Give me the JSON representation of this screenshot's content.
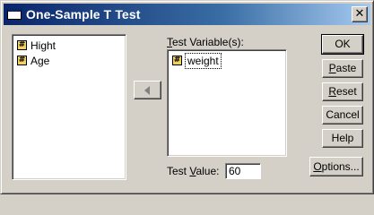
{
  "window": {
    "title": "One-Sample T Test"
  },
  "variable_list": {
    "items": [
      {
        "label": "Hight",
        "icon": "scale-variable-icon"
      },
      {
        "label": "Age",
        "icon": "scale-variable-icon"
      }
    ]
  },
  "test_variables": {
    "label_first": "T",
    "label_rest": "est Variable(s):",
    "items": [
      {
        "label": "weight",
        "icon": "scale-variable-icon"
      }
    ]
  },
  "move_button": {
    "direction": "left",
    "icon": "left-arrow-icon"
  },
  "test_value": {
    "label_pre": "Test ",
    "label_under": "V",
    "label_post": "alue:",
    "value": "60"
  },
  "buttons": {
    "ok": "OK",
    "paste_first": "P",
    "paste_rest": "aste",
    "reset_first": "R",
    "reset_rest": "eset",
    "cancel": "Cancel",
    "help": "Help",
    "options_first": "O",
    "options_rest": "ptions..."
  },
  "colors": {
    "titlebar_start": "#0a246a",
    "titlebar_end": "#a6caf0",
    "dialog_bg": "#d4d0c8",
    "variable_icon": "#f2d25a"
  }
}
